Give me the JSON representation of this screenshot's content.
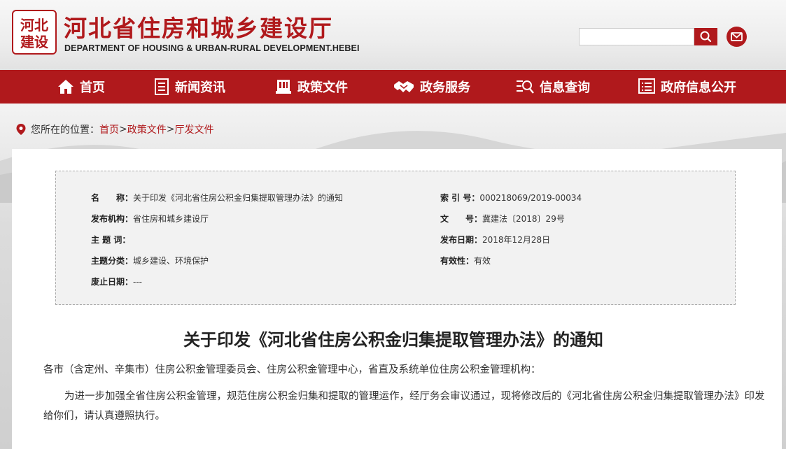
{
  "header": {
    "seal_text": "河北建设",
    "title": "河北省住房和城乡建设厅",
    "subtitle": "DEPARTMENT OF HOUSING & URBAN-RURAL DEVELOPMENT.HEBEI",
    "search_placeholder": "",
    "search_icon": "search-icon",
    "mail_icon": "mail-icon"
  },
  "nav": {
    "items": [
      {
        "label": "首页",
        "icon": "home-icon"
      },
      {
        "label": "新闻资讯",
        "icon": "news-icon"
      },
      {
        "label": "政策文件",
        "icon": "policy-icon"
      },
      {
        "label": "政务服务",
        "icon": "handshake-icon"
      },
      {
        "label": "信息查询",
        "icon": "search-list-icon"
      },
      {
        "label": "政府信息公开",
        "icon": "list-icon"
      }
    ]
  },
  "breadcrumb": {
    "prefix": "您所在的位置：",
    "items": [
      "首页",
      "政策文件",
      "厅发文件"
    ],
    "separator": ">"
  },
  "meta": {
    "name_label": "名　　称：",
    "name_value": "关于印发《河北省住房公积金归集提取管理办法》的通知",
    "index_label": "索 引 号：",
    "index_value": "000218069/2019-00034",
    "org_label": "发布机构：",
    "org_value": "省住房和城乡建设厅",
    "docno_label": "文　　号：",
    "docno_value": "冀建法〔2018〕29号",
    "keywords_label": "主 题 词：",
    "keywords_value": "",
    "date_label": "发布日期：",
    "date_value": "2018年12月28日",
    "category_label": "主题分类：",
    "category_value": "城乡建设、环境保护",
    "validity_label": "有效性：",
    "validity_value": "有效",
    "abolish_label": "废止日期：",
    "abolish_value": "---"
  },
  "document": {
    "title": "关于印发《河北省住房公积金归集提取管理办法》的通知",
    "salutation": "各市（含定州、辛集市）住房公积金管理委员会、住房公积金管理中心，省直及系统单位住房公积金管理机构：",
    "body_line1": "为进一步加强全省住房公积金管理，规范住房公积金归集和提取的管理运作，经厅务会审议通过，现将修改后的《河北省住房公积金归集提取管理办法》印发",
    "body_line2": "给你们，请认真遵照执行。"
  },
  "colors": {
    "brand_red": "#b0191c",
    "meta_bg": "#f2f2f2"
  }
}
